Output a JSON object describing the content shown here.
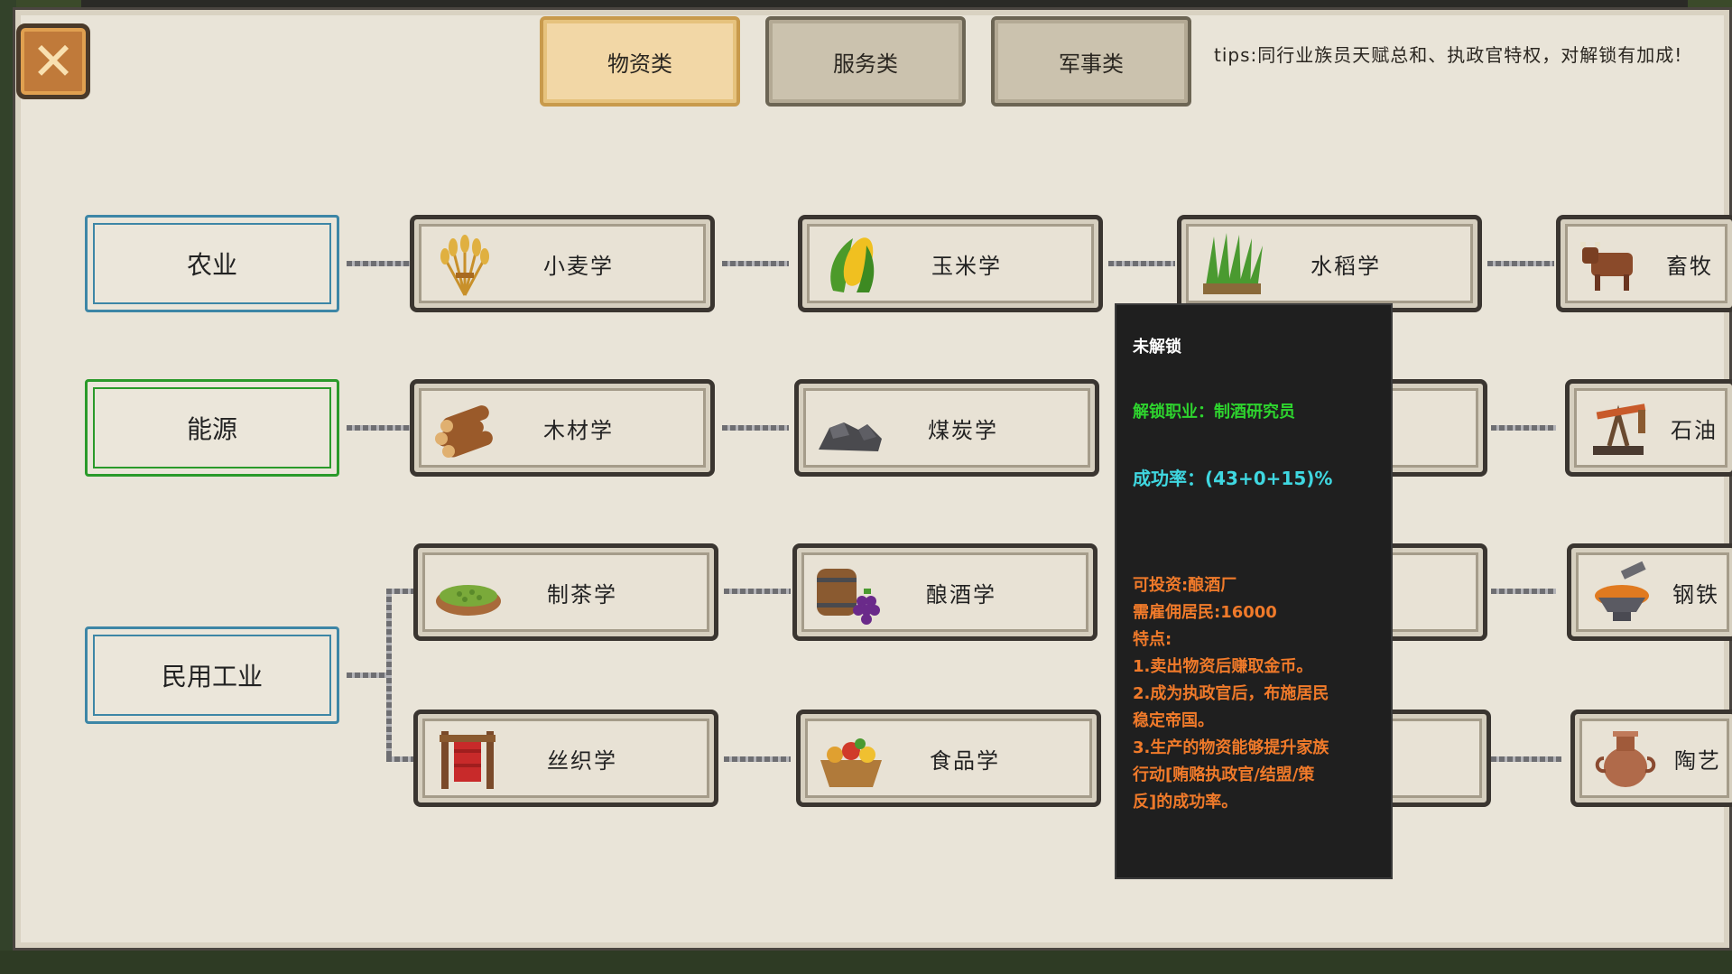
{
  "window": {
    "close_label": "✕"
  },
  "tabs": [
    {
      "label": "物资类",
      "active": true
    },
    {
      "label": "服务类",
      "active": false
    },
    {
      "label": "军事类",
      "active": false
    }
  ],
  "tips": "tips:同行业族员天赋总和、执政官特权，对解锁有加成!",
  "categories": [
    {
      "label": "农业"
    },
    {
      "label": "能源"
    },
    {
      "label": "民用工业"
    }
  ],
  "nodes": {
    "wheat": "小麦学",
    "corn": "玉米学",
    "rice": "水稻学",
    "livestock": "畜牧",
    "wood": "木材学",
    "coal": "煤炭学",
    "oil": "石油",
    "tea": "制茶学",
    "brewing": "酿酒学",
    "steel": "钢铁",
    "silk": "丝织学",
    "food": "食品学",
    "pottery": "陶艺"
  },
  "tooltip": {
    "status": "未解锁",
    "job": "解锁职业：制酒研究员",
    "rate": "成功率：(43+0+15)%",
    "invest": "可投资:酿酒厂",
    "hire": "需雇佣居民:16000",
    "feature_title": "特点:",
    "f1": "1.卖出物资后赚取金币。",
    "f2a": "2.成为执政官后，布施居民",
    "f2b": "稳定帝国。",
    "f3a": "3.生产的物资能够提升家族",
    "f3b": "行动[贿赂执政官/结盟/策",
    "f3c": "反]的成功率。"
  },
  "colors": {
    "tooltip_title": "#ffffff",
    "tooltip_job": "#2ed42e",
    "tooltip_rate": "#3fd7e0",
    "tooltip_info": "#f07a2a",
    "category_blue": "#3d86a6",
    "category_green": "#2a9a2a",
    "tab_active": "#f2d7a6"
  }
}
